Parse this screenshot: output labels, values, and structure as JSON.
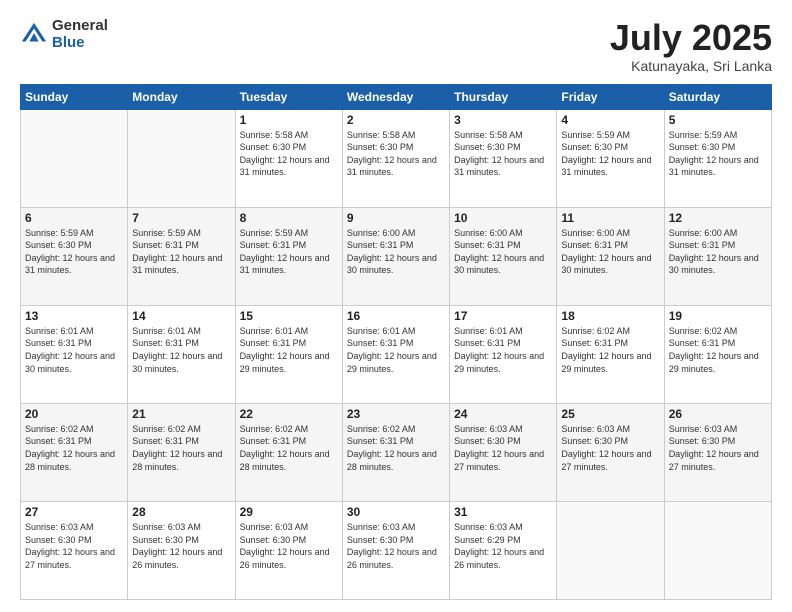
{
  "header": {
    "logo_general": "General",
    "logo_blue": "Blue",
    "month_title": "July 2025",
    "location": "Katunayaka, Sri Lanka"
  },
  "weekdays": [
    "Sunday",
    "Monday",
    "Tuesday",
    "Wednesday",
    "Thursday",
    "Friday",
    "Saturday"
  ],
  "weeks": [
    [
      {
        "day": "",
        "info": ""
      },
      {
        "day": "",
        "info": ""
      },
      {
        "day": "1",
        "info": "Sunrise: 5:58 AM\nSunset: 6:30 PM\nDaylight: 12 hours and 31 minutes."
      },
      {
        "day": "2",
        "info": "Sunrise: 5:58 AM\nSunset: 6:30 PM\nDaylight: 12 hours and 31 minutes."
      },
      {
        "day": "3",
        "info": "Sunrise: 5:58 AM\nSunset: 6:30 PM\nDaylight: 12 hours and 31 minutes."
      },
      {
        "day": "4",
        "info": "Sunrise: 5:59 AM\nSunset: 6:30 PM\nDaylight: 12 hours and 31 minutes."
      },
      {
        "day": "5",
        "info": "Sunrise: 5:59 AM\nSunset: 6:30 PM\nDaylight: 12 hours and 31 minutes."
      }
    ],
    [
      {
        "day": "6",
        "info": "Sunrise: 5:59 AM\nSunset: 6:30 PM\nDaylight: 12 hours and 31 minutes."
      },
      {
        "day": "7",
        "info": "Sunrise: 5:59 AM\nSunset: 6:31 PM\nDaylight: 12 hours and 31 minutes."
      },
      {
        "day": "8",
        "info": "Sunrise: 5:59 AM\nSunset: 6:31 PM\nDaylight: 12 hours and 31 minutes."
      },
      {
        "day": "9",
        "info": "Sunrise: 6:00 AM\nSunset: 6:31 PM\nDaylight: 12 hours and 30 minutes."
      },
      {
        "day": "10",
        "info": "Sunrise: 6:00 AM\nSunset: 6:31 PM\nDaylight: 12 hours and 30 minutes."
      },
      {
        "day": "11",
        "info": "Sunrise: 6:00 AM\nSunset: 6:31 PM\nDaylight: 12 hours and 30 minutes."
      },
      {
        "day": "12",
        "info": "Sunrise: 6:00 AM\nSunset: 6:31 PM\nDaylight: 12 hours and 30 minutes."
      }
    ],
    [
      {
        "day": "13",
        "info": "Sunrise: 6:01 AM\nSunset: 6:31 PM\nDaylight: 12 hours and 30 minutes."
      },
      {
        "day": "14",
        "info": "Sunrise: 6:01 AM\nSunset: 6:31 PM\nDaylight: 12 hours and 30 minutes."
      },
      {
        "day": "15",
        "info": "Sunrise: 6:01 AM\nSunset: 6:31 PM\nDaylight: 12 hours and 29 minutes."
      },
      {
        "day": "16",
        "info": "Sunrise: 6:01 AM\nSunset: 6:31 PM\nDaylight: 12 hours and 29 minutes."
      },
      {
        "day": "17",
        "info": "Sunrise: 6:01 AM\nSunset: 6:31 PM\nDaylight: 12 hours and 29 minutes."
      },
      {
        "day": "18",
        "info": "Sunrise: 6:02 AM\nSunset: 6:31 PM\nDaylight: 12 hours and 29 minutes."
      },
      {
        "day": "19",
        "info": "Sunrise: 6:02 AM\nSunset: 6:31 PM\nDaylight: 12 hours and 29 minutes."
      }
    ],
    [
      {
        "day": "20",
        "info": "Sunrise: 6:02 AM\nSunset: 6:31 PM\nDaylight: 12 hours and 28 minutes."
      },
      {
        "day": "21",
        "info": "Sunrise: 6:02 AM\nSunset: 6:31 PM\nDaylight: 12 hours and 28 minutes."
      },
      {
        "day": "22",
        "info": "Sunrise: 6:02 AM\nSunset: 6:31 PM\nDaylight: 12 hours and 28 minutes."
      },
      {
        "day": "23",
        "info": "Sunrise: 6:02 AM\nSunset: 6:31 PM\nDaylight: 12 hours and 28 minutes."
      },
      {
        "day": "24",
        "info": "Sunrise: 6:03 AM\nSunset: 6:30 PM\nDaylight: 12 hours and 27 minutes."
      },
      {
        "day": "25",
        "info": "Sunrise: 6:03 AM\nSunset: 6:30 PM\nDaylight: 12 hours and 27 minutes."
      },
      {
        "day": "26",
        "info": "Sunrise: 6:03 AM\nSunset: 6:30 PM\nDaylight: 12 hours and 27 minutes."
      }
    ],
    [
      {
        "day": "27",
        "info": "Sunrise: 6:03 AM\nSunset: 6:30 PM\nDaylight: 12 hours and 27 minutes."
      },
      {
        "day": "28",
        "info": "Sunrise: 6:03 AM\nSunset: 6:30 PM\nDaylight: 12 hours and 26 minutes."
      },
      {
        "day": "29",
        "info": "Sunrise: 6:03 AM\nSunset: 6:30 PM\nDaylight: 12 hours and 26 minutes."
      },
      {
        "day": "30",
        "info": "Sunrise: 6:03 AM\nSunset: 6:30 PM\nDaylight: 12 hours and 26 minutes."
      },
      {
        "day": "31",
        "info": "Sunrise: 6:03 AM\nSunset: 6:29 PM\nDaylight: 12 hours and 26 minutes."
      },
      {
        "day": "",
        "info": ""
      },
      {
        "day": "",
        "info": ""
      }
    ]
  ]
}
